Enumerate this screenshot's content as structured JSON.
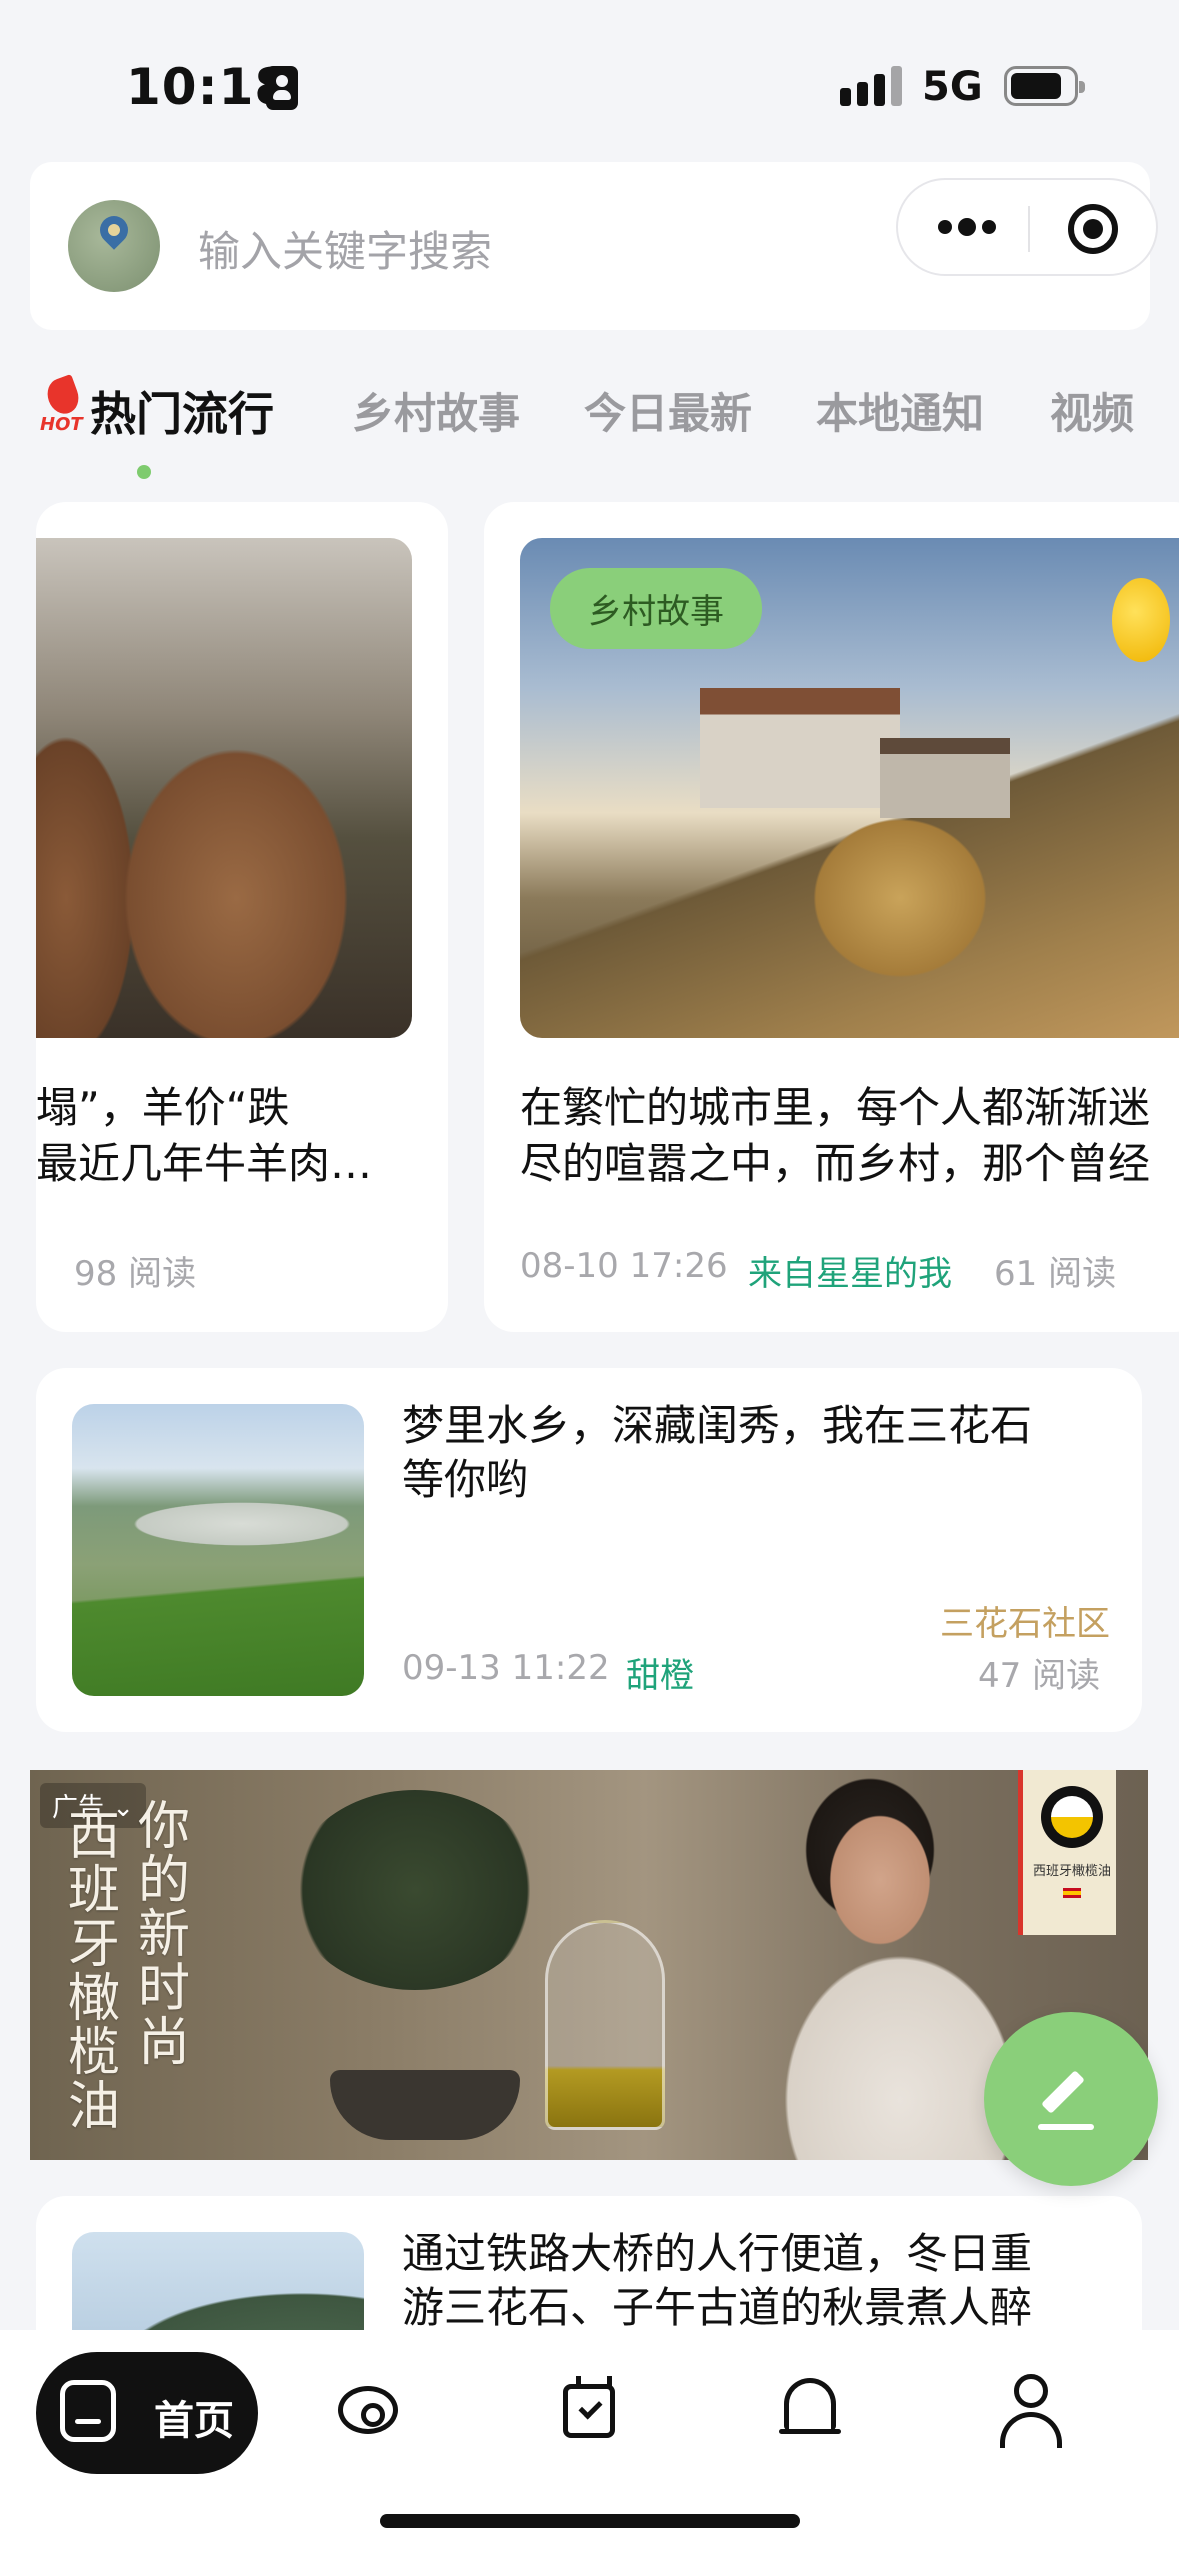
{
  "status_bar": {
    "time": "10:18",
    "network": "5G",
    "battery_level": 0.8
  },
  "search": {
    "placeholder": "输入关键字搜索"
  },
  "tabs": [
    {
      "label": "热门流行",
      "active": true,
      "badge": "HOT"
    },
    {
      "label": "乡村故事"
    },
    {
      "label": "今日最新"
    },
    {
      "label": "本地通知"
    },
    {
      "label": "视频"
    }
  ],
  "featured": [
    {
      "title_line1": "塌”，羊价“跌",
      "title_line2": "最近几年牛羊肉…",
      "reads": "98 阅读"
    },
    {
      "tag": "乡村故事",
      "title_line1": "在繁忙的城市里，每个人都渐渐迷",
      "title_line2": "尽的喧嚣之中，而乡村，那个曾经",
      "date": "08-10 17:26",
      "author": "来自星星的我",
      "reads": "61 阅读"
    }
  ],
  "posts": [
    {
      "title": "梦里水乡，深藏闺秀，我在三花石等你哟",
      "title_line1": "梦里水乡，深藏闺秀，我在三花石",
      "title_line2": "等你哟",
      "community": "三花石社区",
      "date": "09-13 11:22",
      "author": "甜橙",
      "reads": "47 阅读"
    },
    {
      "title_line1": "通过铁路大桥的人行便道，冬日重",
      "title_line2": "游三花石、子午古道的秋景煮人醉"
    }
  ],
  "ad": {
    "label": "广告",
    "col1": [
      "西",
      "班",
      "牙",
      "橄",
      "榄",
      "油"
    ],
    "col2": [
      "你",
      "的",
      "新",
      "时",
      "尚"
    ],
    "brand": "西班牙橄榄油"
  },
  "bottom_nav": {
    "home_label": "首页"
  },
  "colors": {
    "accent": "#8acf7a",
    "author": "#1fa37a",
    "community": "#c4a060",
    "hot": "#e8342b"
  }
}
